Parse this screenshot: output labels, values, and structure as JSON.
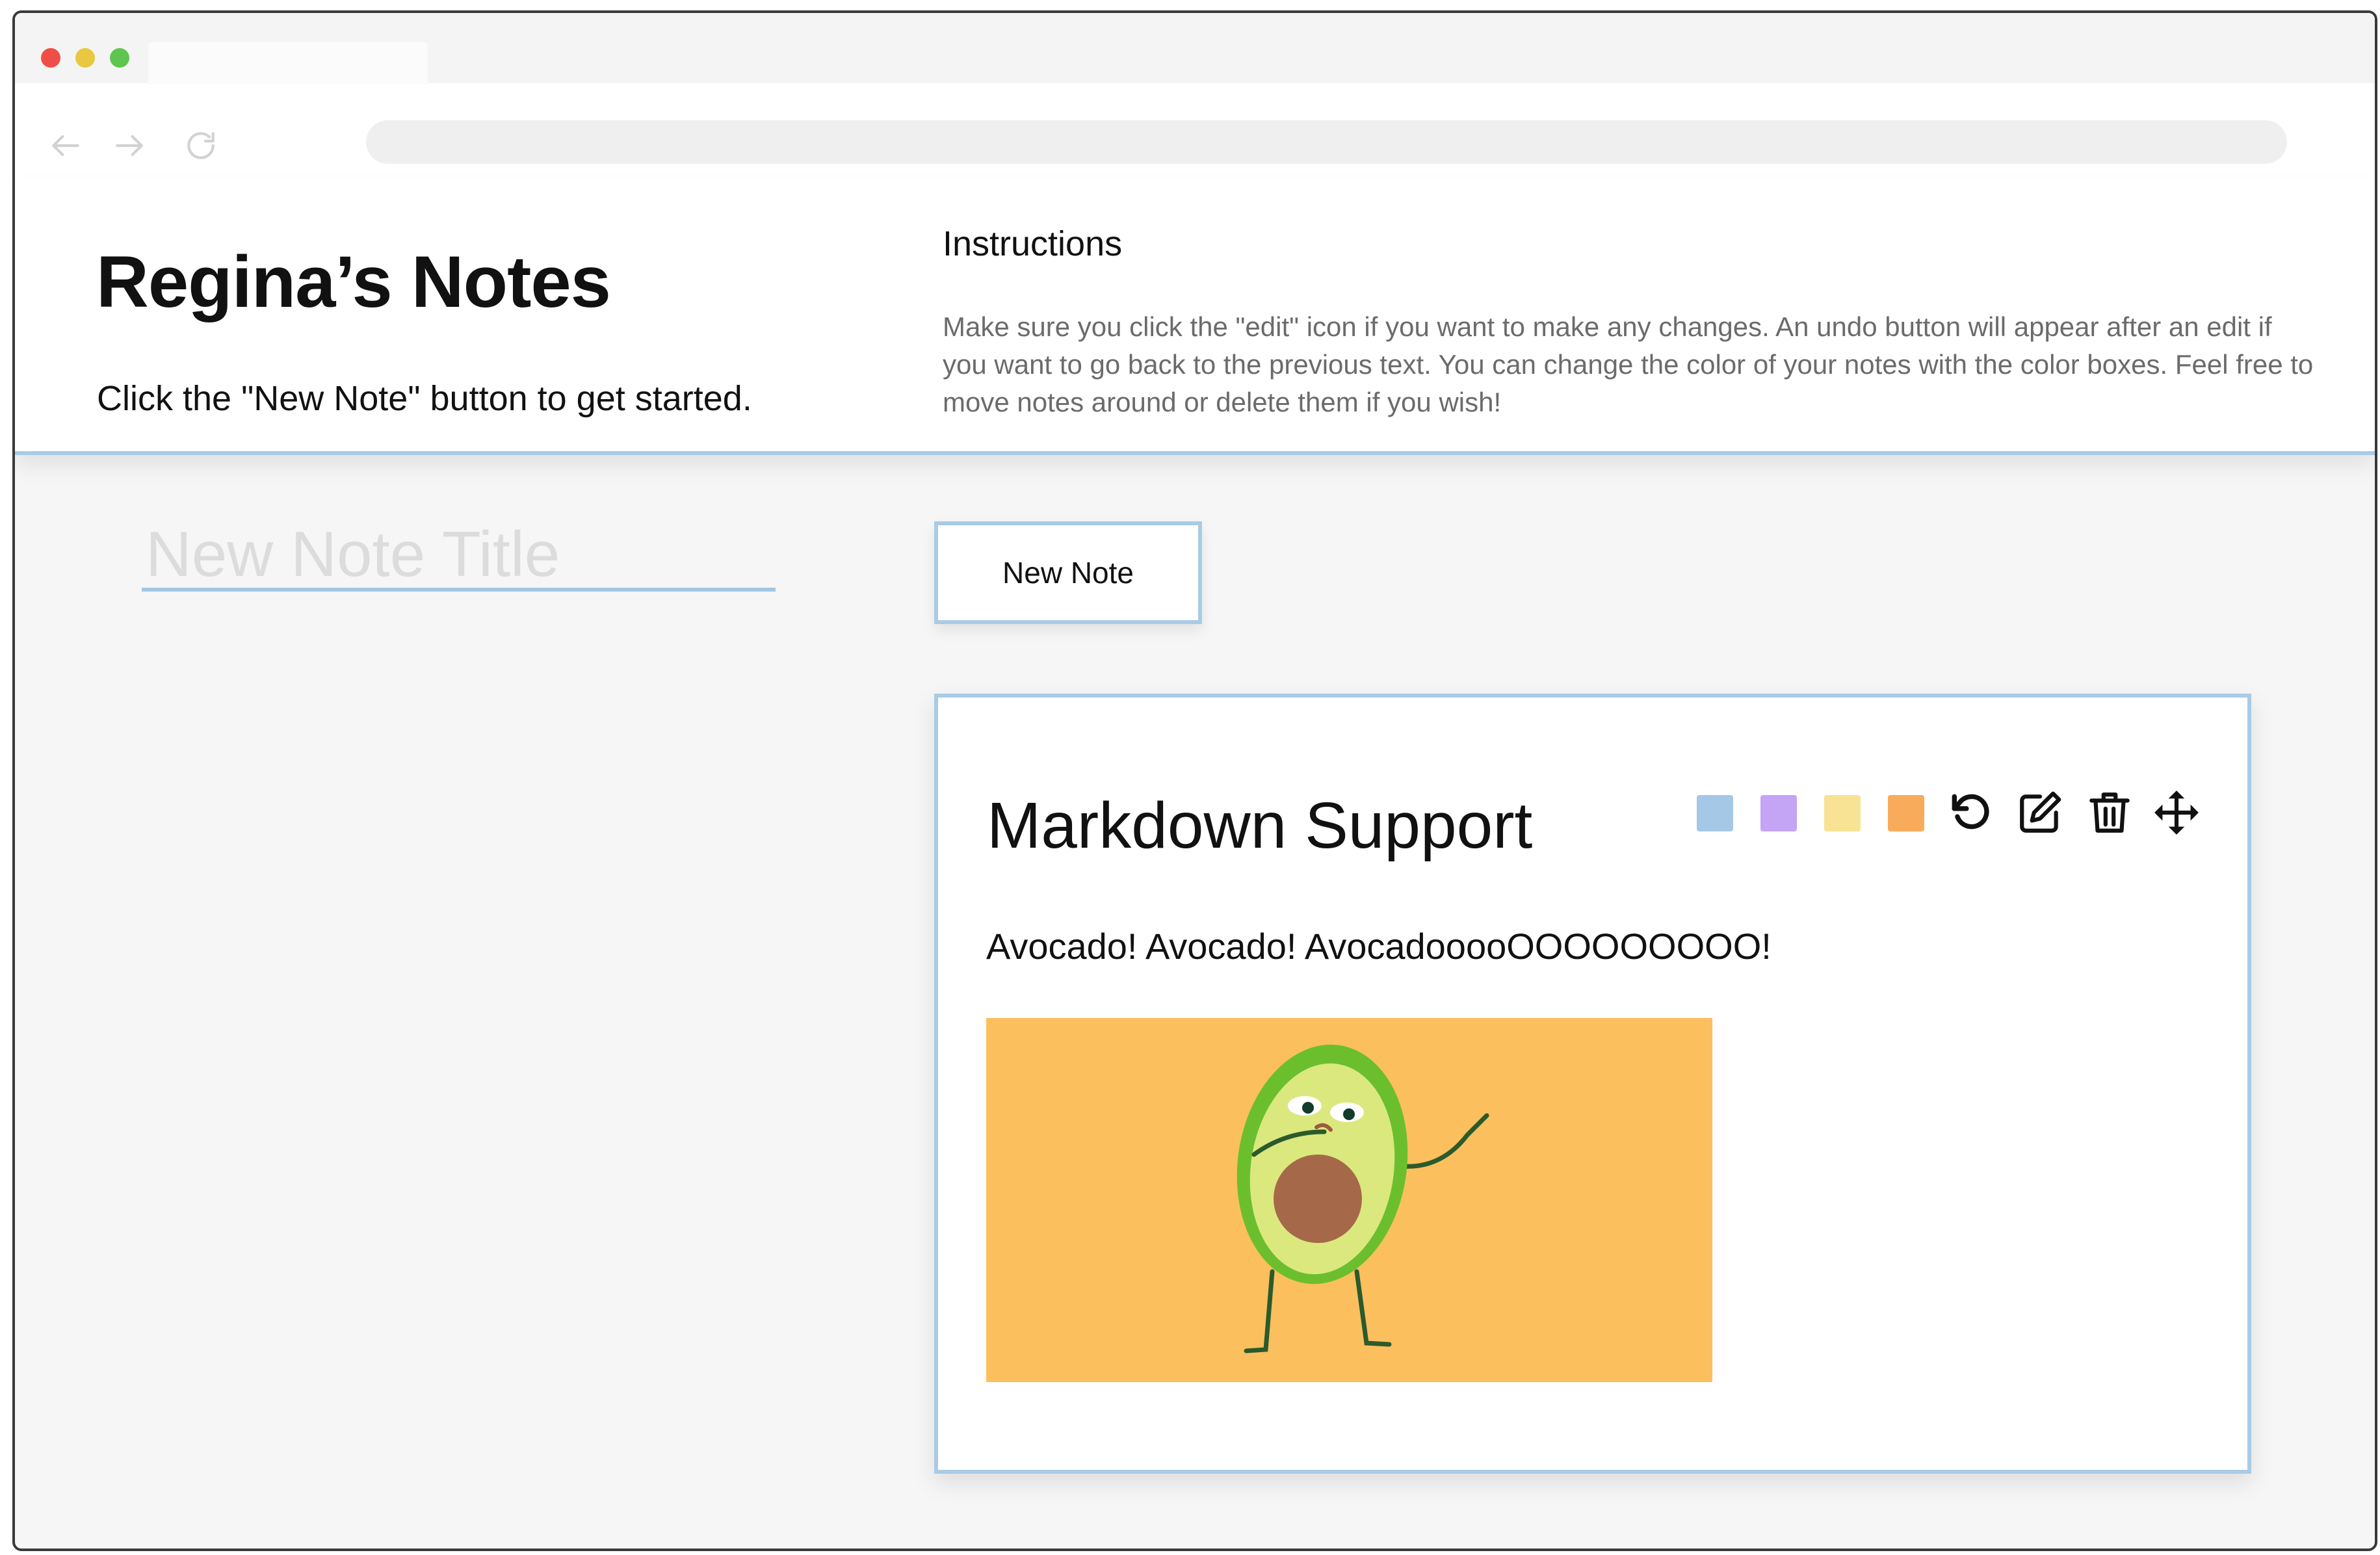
{
  "browser": {
    "tab_title": "",
    "url": "",
    "icons": [
      "back-arrow-icon",
      "forward-arrow-icon",
      "reload-icon"
    ]
  },
  "header": {
    "title": "Regina’s Notes",
    "subtitle": "Click the \"New Note\" button to get started.",
    "instructions_heading": "Instructions",
    "instructions_text": "Make sure you click the \"edit\" icon if you want to make any changes. An undo button will appear after an edit if you want to go back to the previous text. You can change the color of your notes with the color boxes. Feel free to move notes around or delete them if you wish!"
  },
  "form": {
    "title_placeholder": "New Note Title",
    "title_value": "",
    "new_note_label": "New Note"
  },
  "note": {
    "title": "Markdown Support",
    "body": "Avocado! Avocado! AvocadooooOOOOOOOOO!",
    "swatches": [
      "#a4c8e6",
      "#c3a4f5",
      "#f7e393",
      "#f8ab5b"
    ],
    "tools": [
      "undo-icon",
      "edit-icon",
      "trash-icon",
      "move-icon"
    ],
    "image_background": "#fcbf5e"
  },
  "colors": {
    "accent_border": "#a8cbe6",
    "page_background": "#f6f6f6"
  }
}
